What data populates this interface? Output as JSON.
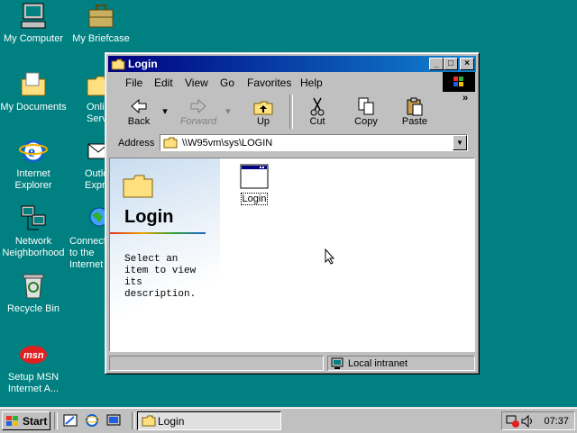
{
  "desktop": {
    "icons": [
      {
        "label": "My Computer"
      },
      {
        "label": "My Briefcase"
      },
      {
        "label": "My Documents"
      },
      {
        "label": "Online Services"
      },
      {
        "label": "Internet Explorer"
      },
      {
        "label": "Outlook Express"
      },
      {
        "label": "Network Neighborhood"
      },
      {
        "label": "Connect to the Internet"
      },
      {
        "label": "Recycle Bin"
      },
      {
        "label": "Setup MSN Internet A..."
      }
    ]
  },
  "window": {
    "title": "Login",
    "menu": [
      "File",
      "Edit",
      "View",
      "Go",
      "Favorites",
      "Help"
    ],
    "toolbar": {
      "back": "Back",
      "forward": "Forward",
      "up": "Up",
      "cut": "Cut",
      "copy": "Copy",
      "paste": "Paste"
    },
    "address": {
      "label": "Address",
      "value": "\\\\W95vm\\sys\\LOGIN"
    },
    "webpanel": {
      "title": "Login",
      "description": "Select an item to view its description."
    },
    "files": [
      {
        "label": "Login"
      }
    ],
    "status": {
      "zone": "Local intranet"
    }
  },
  "taskbar": {
    "start_label": "Start",
    "task_label": "Login",
    "clock": "07:37"
  },
  "colors": {
    "desktop": "#008080",
    "titlebar_start": "#000080",
    "titlebar_end": "#1084d0",
    "face": "#c0c0c0"
  }
}
